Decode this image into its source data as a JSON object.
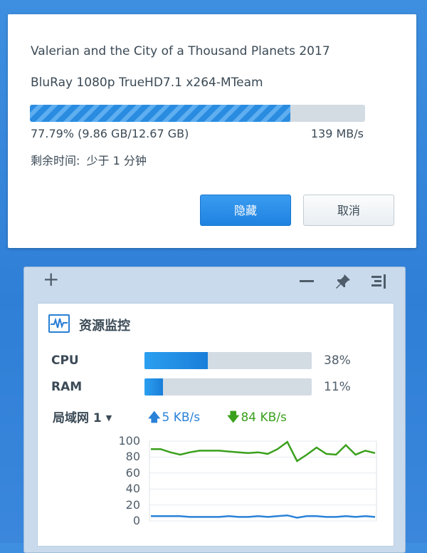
{
  "dialog": {
    "title": "Valerian and the City of a Thousand Planets 2017",
    "subtitle": "BluRay 1080p TrueHD7.1 x264-MTeam",
    "progress": 0.7779,
    "progress_text": "77.79% (9.86 GB/12.67 GB)",
    "speed_text": "139 MB/s",
    "remaining_label": "剩余时间:",
    "remaining_value": "少于 1 分钟",
    "hide_label": "隐藏",
    "cancel_label": "取消"
  },
  "toolbar": {
    "add_icon": "plus-icon",
    "minimize_icon": "minus-icon",
    "pin_icon": "pin-icon",
    "menu_icon": "menu-icon"
  },
  "monitor": {
    "title": "资源监控",
    "icon": "activity-monitor-icon",
    "cpu": {
      "label": "CPU",
      "percent": 38,
      "value_text": "38%"
    },
    "ram": {
      "label": "RAM",
      "percent": 11,
      "value_text": "11%"
    },
    "network": {
      "selected": "局域网 1",
      "upload": "5 KB/s",
      "download": "84 KB/s"
    }
  },
  "colors": {
    "accent": "#1f82e0",
    "upload_line": "#2a82d8",
    "download_line": "#3aa01c"
  },
  "chart_data": {
    "type": "line",
    "yticks": [
      "100",
      "80",
      "60",
      "40",
      "20",
      "0"
    ],
    "ylim": [
      0,
      100
    ],
    "grid": true,
    "series": [
      {
        "values": [
          90,
          90,
          86,
          83,
          86,
          88,
          88,
          88,
          87,
          86,
          85,
          86,
          84,
          90,
          99,
          75,
          83,
          92,
          84,
          83,
          95,
          83,
          88,
          85
        ]
      },
      {
        "values": [
          6,
          6,
          6,
          6,
          5,
          5,
          5,
          5,
          6,
          5,
          5,
          6,
          5,
          6,
          7,
          4,
          6,
          6,
          5,
          5,
          6,
          5,
          6,
          5
        ]
      }
    ]
  }
}
